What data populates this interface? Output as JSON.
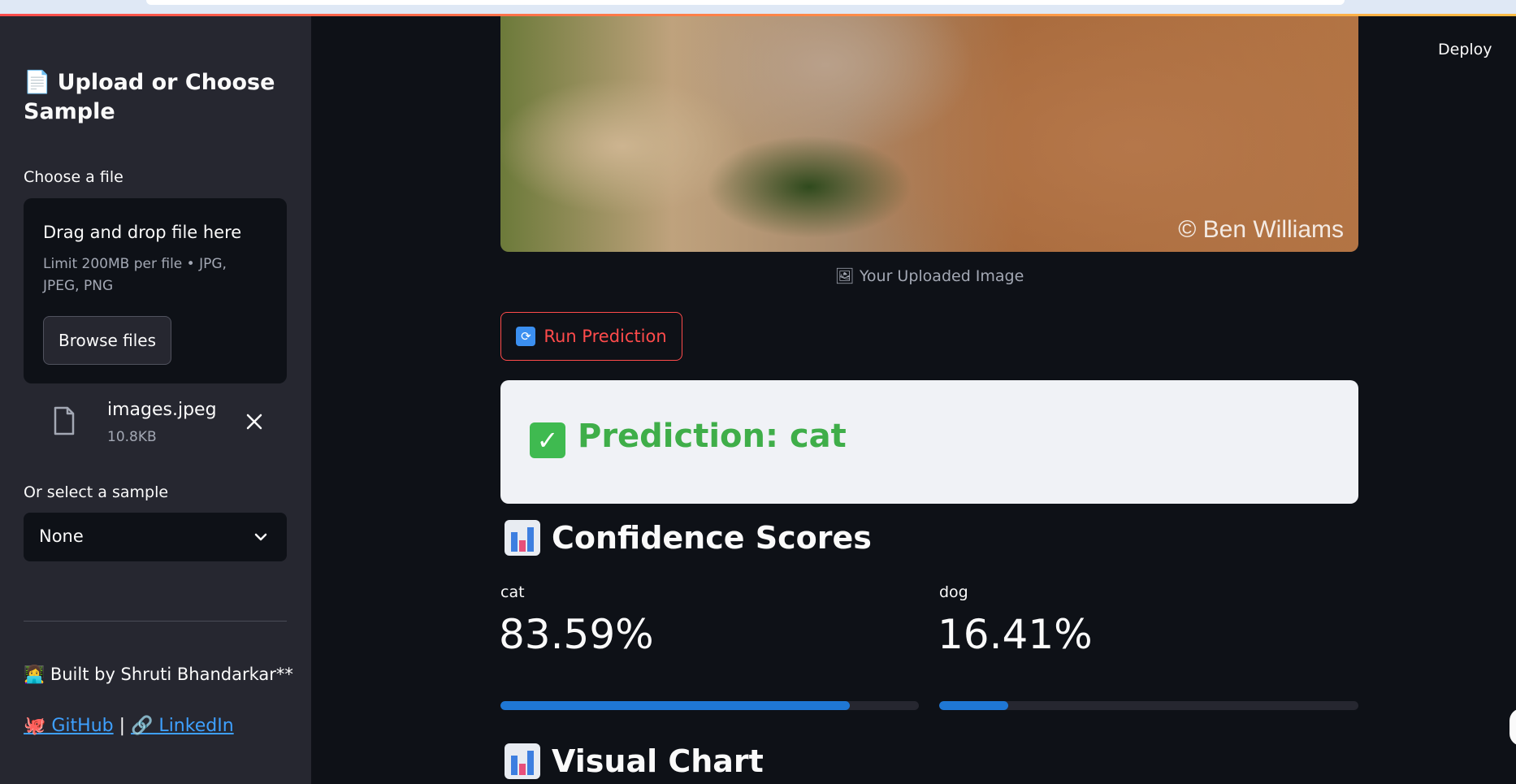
{
  "sidebar": {
    "title": "Upload or Choose Sample",
    "title_icon": "📄",
    "uploader_label": "Choose a file",
    "dropzone_title": "Drag and drop file here",
    "dropzone_limit": "Limit 200MB per file • JPG, JPEG, PNG",
    "browse_label": "Browse files",
    "file": {
      "name": "images.jpeg",
      "size": "10.8KB"
    },
    "sample_label": "Or select a sample",
    "sample_value": "None",
    "built_by": "👩‍💻 Built by Shruti Bhandarkar**",
    "github_label": "🐙 GitHub",
    "separator": "|",
    "linkedin_label": "🔗 LinkedIn"
  },
  "header": {
    "deploy_label": "Deploy"
  },
  "main": {
    "image_watermark": "© Ben Williams",
    "image_caption": "🖼 Your Uploaded Image",
    "run_button_label": "Run Prediction",
    "run_button_icon": "🔁",
    "prediction_text": "Prediction: cat",
    "confidence_heading": "Confidence Scores",
    "chart_heading": "Visual Chart",
    "metrics": [
      {
        "label": "cat",
        "value": "83.59%",
        "fraction": 0.8359
      },
      {
        "label": "dog",
        "value": "16.41%",
        "fraction": 0.1641
      }
    ]
  },
  "colors": {
    "accent": "#ff4b4b",
    "sidebar_bg": "#262730",
    "app_bg": "#0e1117",
    "progress": "#1f77d4",
    "success": "#3fae49",
    "link": "#3ea0ff"
  }
}
